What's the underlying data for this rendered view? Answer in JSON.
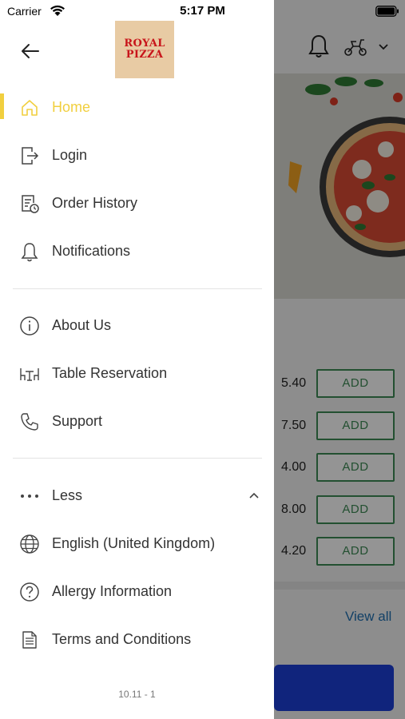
{
  "status_bar": {
    "carrier": "Carrier",
    "time": "5:17 PM"
  },
  "brand": {
    "logo_line1": "ROYAL",
    "logo_line2": "PIZZA"
  },
  "menu": {
    "primary": [
      {
        "label": "Home",
        "icon": "home-icon",
        "active": true
      },
      {
        "label": "Login",
        "icon": "login-icon"
      },
      {
        "label": "Order History",
        "icon": "order-history-icon"
      },
      {
        "label": "Notifications",
        "icon": "bell-icon"
      }
    ],
    "secondary": [
      {
        "label": "About Us",
        "icon": "info-icon"
      },
      {
        "label": "Table Reservation",
        "icon": "table-icon"
      },
      {
        "label": "Support",
        "icon": "phone-icon"
      }
    ],
    "less_label": "Less",
    "tertiary": [
      {
        "label": "English (United Kingdom)",
        "icon": "globe-icon"
      },
      {
        "label": "Allergy Information",
        "icon": "question-icon"
      },
      {
        "label": "Terms and Conditions",
        "icon": "document-icon"
      }
    ]
  },
  "version": "10.11 - 1",
  "background": {
    "items": [
      {
        "price": "5.40",
        "add_label": "ADD"
      },
      {
        "price": "7.50",
        "add_label": "ADD"
      },
      {
        "price": "4.00",
        "add_label": "ADD"
      },
      {
        "price": "8.00",
        "add_label": "ADD"
      },
      {
        "price": "4.20",
        "add_label": "ADD"
      }
    ],
    "view_all": "View all"
  },
  "colors": {
    "accent": "#f1cf3f",
    "add_green": "#3d8a55",
    "link_blue": "#1f6fb0",
    "cta_blue": "#1d3fd6",
    "logo_bg": "#e8cba4",
    "logo_red": "#c8151b"
  }
}
